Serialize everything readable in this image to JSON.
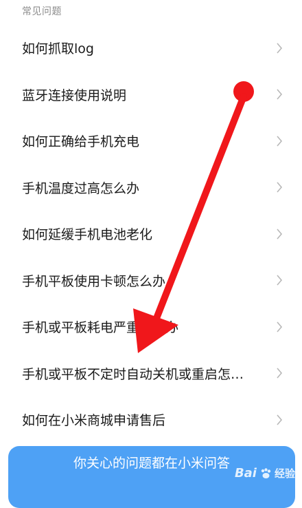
{
  "section_header": "常见问题",
  "faq_items": [
    {
      "label": "如何抓取log"
    },
    {
      "label": "蓝牙连接使用说明"
    },
    {
      "label": "如何正确给手机充电"
    },
    {
      "label": "手机温度过高怎么办"
    },
    {
      "label": "如何延缓手机电池老化"
    },
    {
      "label": "手机平板使用卡顿怎么办"
    },
    {
      "label": "手机或平板耗电严重怎么办"
    },
    {
      "label": "手机或平板不定时自动关机或重启怎…"
    },
    {
      "label": "如何在小米商城申请售后"
    }
  ],
  "banner": {
    "title": "你关心的问题都在小米问答"
  },
  "watermark": {
    "logo": "Bai",
    "text": "经验"
  },
  "colors": {
    "annotation_arrow": "#f0171b",
    "banner_bg": "#4ea1f5",
    "chevron": "#b8b8b8"
  },
  "icons": {
    "row_chevron": "chevron-right-icon",
    "watermark_paw": "baidu-paw-icon"
  }
}
